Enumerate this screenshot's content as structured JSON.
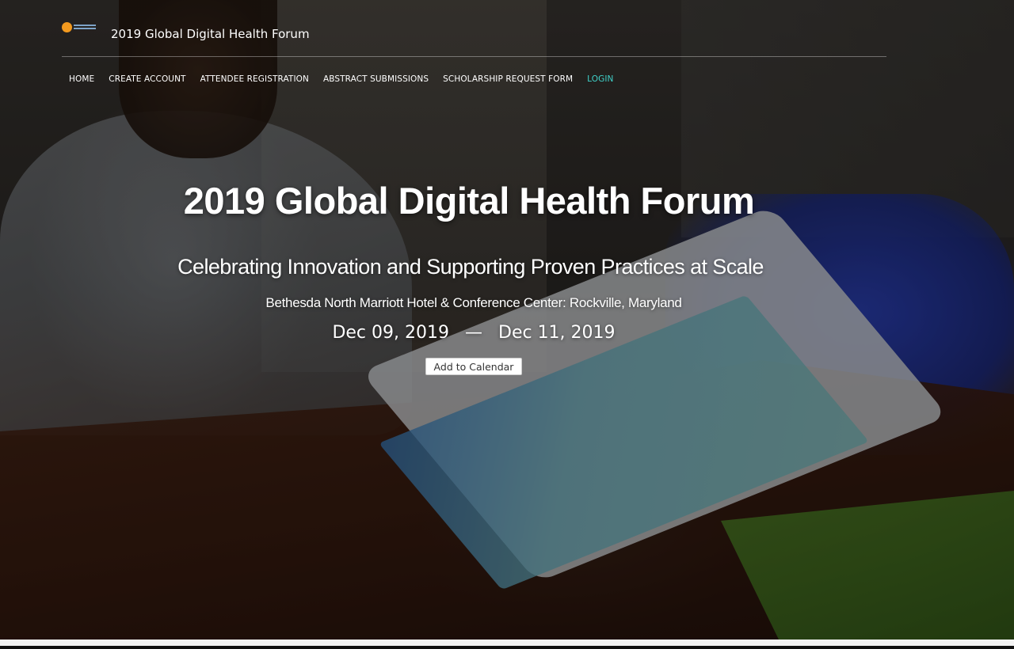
{
  "header": {
    "logo_icon": "forum-logo-icon",
    "site_title": "2019 Global Digital Health Forum"
  },
  "nav": {
    "items": [
      {
        "label": "HOME",
        "active": false
      },
      {
        "label": "CREATE ACCOUNT",
        "active": false
      },
      {
        "label": "ATTENDEE REGISTRATION",
        "active": false
      },
      {
        "label": "ABSTRACT SUBMISSIONS",
        "active": false
      },
      {
        "label": "SCHOLARSHIP REQUEST FORM",
        "active": false
      },
      {
        "label": "LOGIN",
        "active": true
      }
    ]
  },
  "hero": {
    "title": "2019 Global Digital Health Forum",
    "subtitle": "Celebrating Innovation and Supporting Proven Practices at Scale",
    "venue": "Bethesda North Marriott Hotel & Conference Center: Rockville, Maryland",
    "start_date": "Dec 09, 2019",
    "date_separator": "—",
    "end_date": "Dec 11, 2019",
    "calendar_button": "Add to Calendar"
  },
  "colors": {
    "nav_active": "#3fd0c8",
    "logo_accent": "#f39a1f"
  }
}
